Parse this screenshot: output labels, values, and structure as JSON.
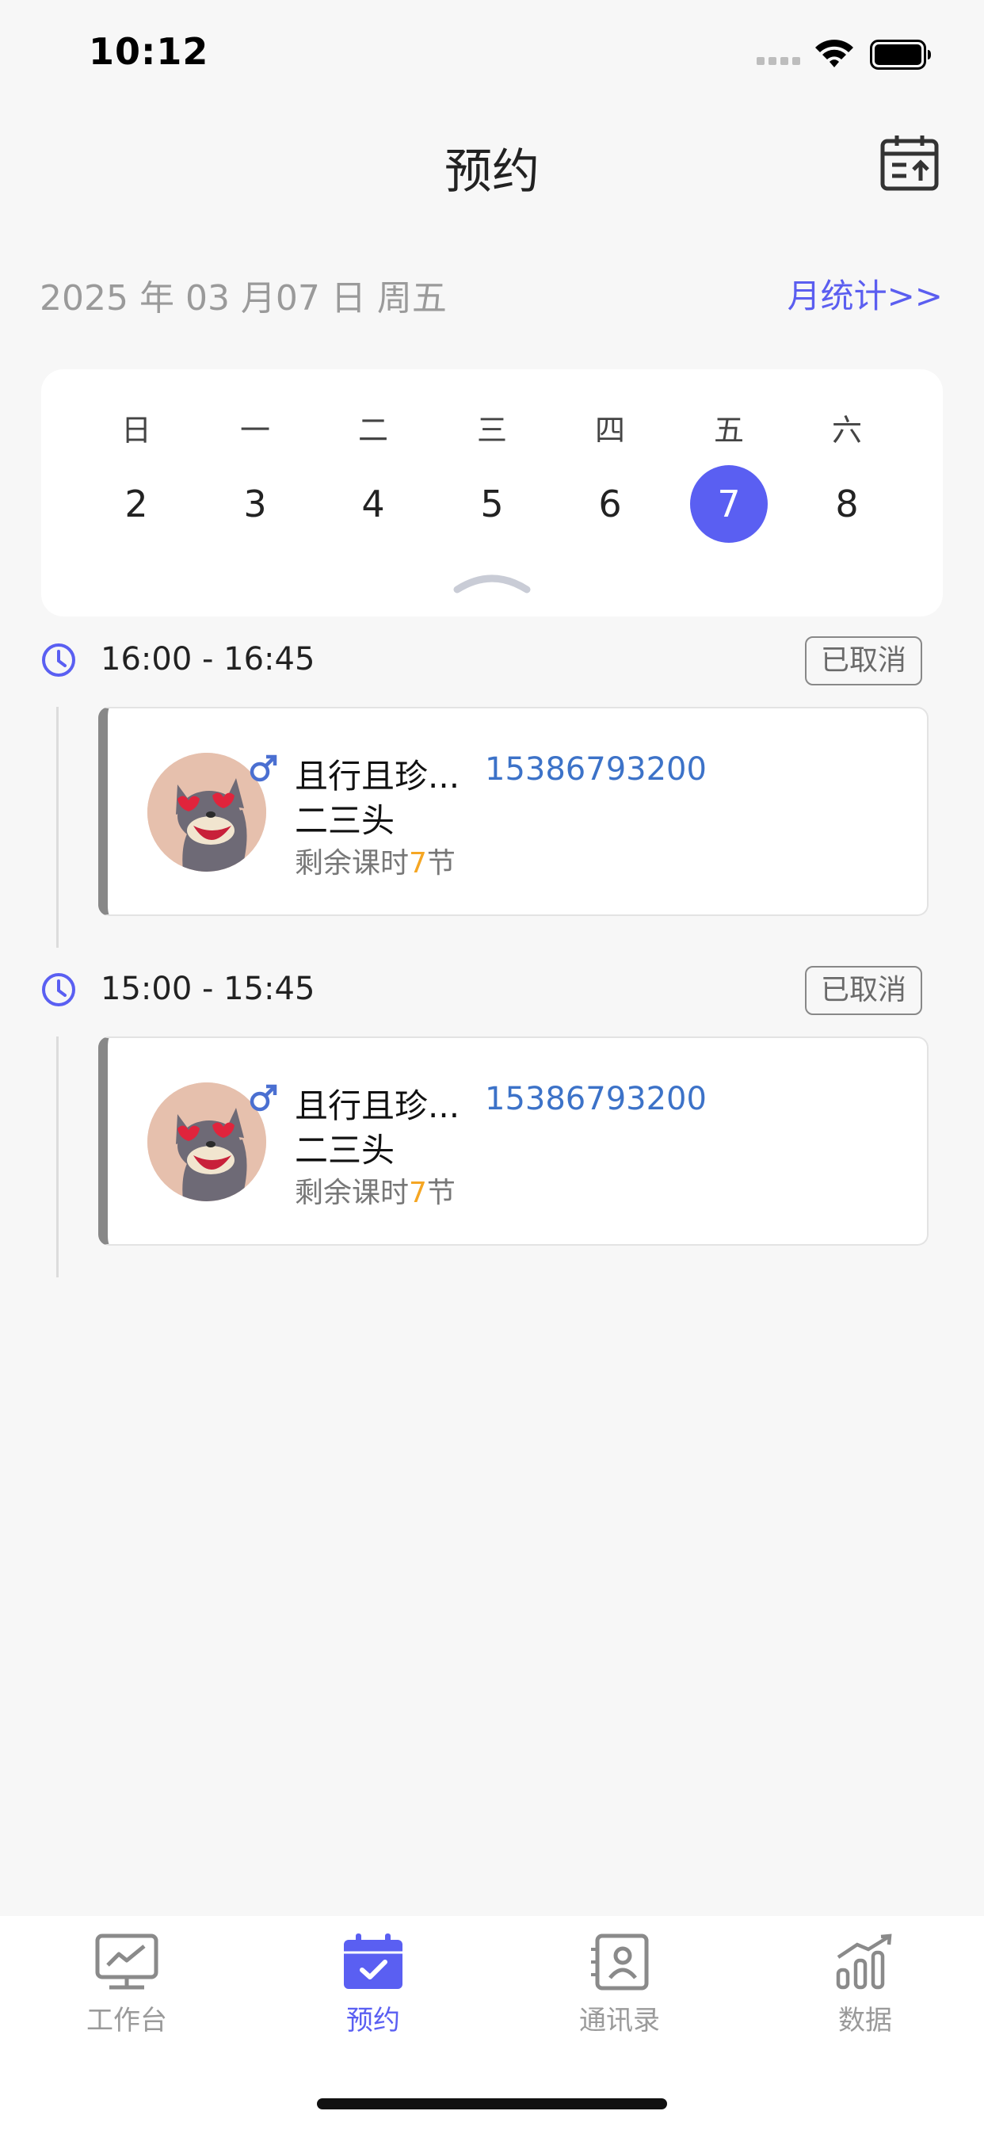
{
  "status_bar": {
    "time": "10:12"
  },
  "nav": {
    "title": "预约"
  },
  "date_row": {
    "date": "2025 年 03 月07 日 周五",
    "stats_link": "月统计>>"
  },
  "week": {
    "days": [
      {
        "label": "日",
        "date": "2",
        "selected": false
      },
      {
        "label": "一",
        "date": "3",
        "selected": false
      },
      {
        "label": "二",
        "date": "4",
        "selected": false
      },
      {
        "label": "三",
        "date": "5",
        "selected": false
      },
      {
        "label": "四",
        "date": "6",
        "selected": false
      },
      {
        "label": "五",
        "date": "7",
        "selected": true
      },
      {
        "label": "六",
        "date": "8",
        "selected": false
      }
    ]
  },
  "appointments": [
    {
      "time": "16:00 - 16:45",
      "status": "已取消",
      "student": {
        "name": "且行且珍...",
        "phone": "15386793200",
        "course": "二三头",
        "remaining_prefix": "剩余课时",
        "remaining_count": "7",
        "remaining_suffix": "节"
      }
    },
    {
      "time": "15:00 - 15:45",
      "status": "已取消",
      "student": {
        "name": "且行且珍...",
        "phone": "15386793200",
        "course": "二三头",
        "remaining_prefix": "剩余课时",
        "remaining_count": "7",
        "remaining_suffix": "节"
      }
    }
  ],
  "tabs": [
    {
      "label": "工作台",
      "icon": "workbench-icon",
      "active": false
    },
    {
      "label": "预约",
      "icon": "calendar-check-icon",
      "active": true
    },
    {
      "label": "通讯录",
      "icon": "contacts-icon",
      "active": false
    },
    {
      "label": "数据",
      "icon": "data-chart-icon",
      "active": false
    }
  ],
  "colors": {
    "accent": "#5a5ff2",
    "phone": "#3c72c8",
    "remaining": "#f5a623",
    "background": "#f7f7f7"
  }
}
